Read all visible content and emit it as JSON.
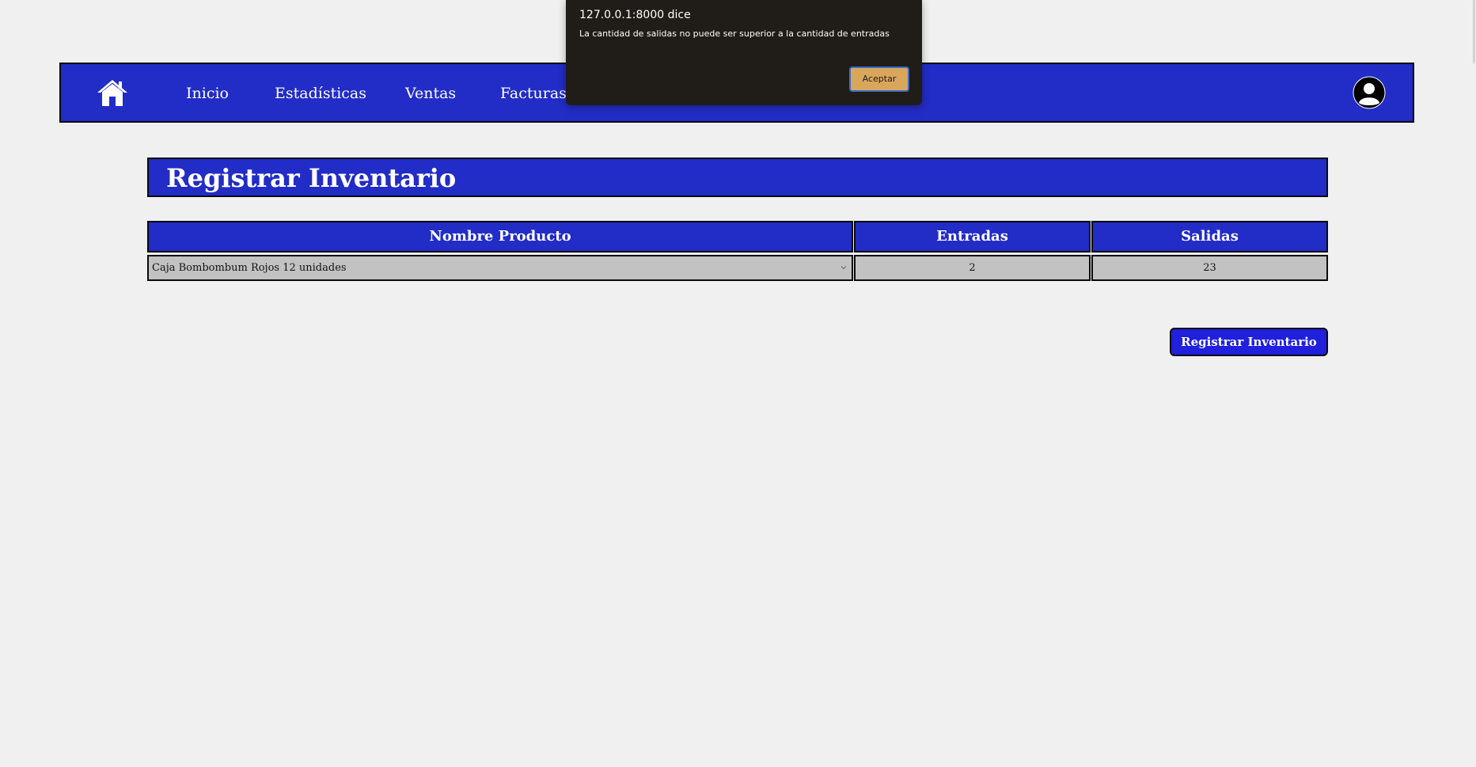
{
  "nav": {
    "items": [
      {
        "label": "Inicio"
      },
      {
        "label": "Estadísticas"
      },
      {
        "label": "Ventas"
      },
      {
        "label": "Facturas"
      }
    ],
    "home_icon": "home-icon",
    "user_icon": "user-circle-icon"
  },
  "page": {
    "title": "Registrar Inventario"
  },
  "table": {
    "headers": [
      "Nombre Producto",
      "Entradas",
      "Salidas"
    ],
    "row": {
      "product": "Caja Bombombum Rojos 12 unidades",
      "entradas": "2",
      "salidas": "23"
    }
  },
  "actions": {
    "submit_label": "Registrar Inventario"
  },
  "alert": {
    "title": "127.0.0.1:8000 dice",
    "message": "La cantidad de salidas no puede ser superior a la cantidad de entradas",
    "button_label": "Aceptar"
  },
  "colors": {
    "primary": "#222cc6",
    "button": "#2020dd",
    "background": "#f0f0f0",
    "cell": "#c2c2c2",
    "dialog": "#201c17",
    "dialog_button": "#d9a75b"
  }
}
